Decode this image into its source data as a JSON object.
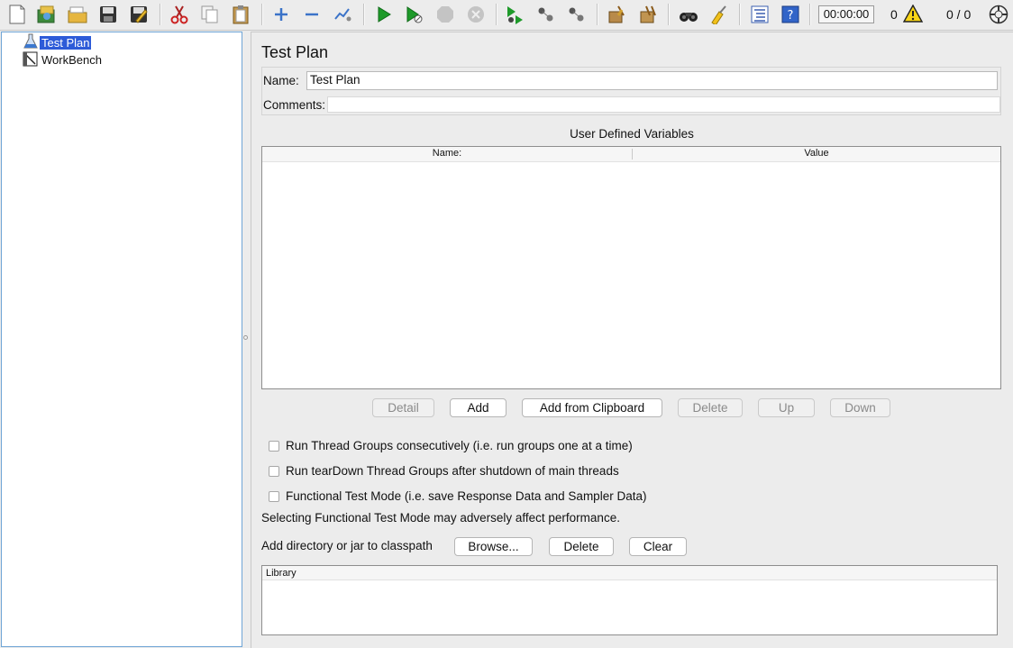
{
  "toolbar": {
    "icons": [
      "new-icon",
      "templates-icon",
      "open-icon",
      "save-icon",
      "save-as-icon",
      "cut-icon",
      "copy-icon",
      "paste-icon",
      "expand-icon",
      "collapse-icon",
      "toggle-icon",
      "start-icon",
      "start-no-pauses-icon",
      "stop-icon",
      "shutdown-icon",
      "remote-start-icon",
      "remote-stop-icon",
      "remote-shutdown-icon",
      "clear-icon",
      "clear-all-icon",
      "search-icon",
      "reset-search-icon",
      "function-helper-icon",
      "help-icon"
    ],
    "timer": "00:00:00",
    "error_count": "0",
    "thread_count": "0 / 0"
  },
  "tree": {
    "items": [
      {
        "label": "Test Plan",
        "icon": "flask-icon",
        "selected": true
      },
      {
        "label": "WorkBench",
        "icon": "workbench-icon",
        "selected": false
      }
    ]
  },
  "panel": {
    "title": "Test Plan",
    "name_label": "Name:",
    "name_value": "Test Plan",
    "comments_label": "Comments:",
    "comments_value": "",
    "variables_title": "User Defined Variables",
    "columns": [
      "Name:",
      "Value"
    ],
    "buttons": {
      "detail": "Detail",
      "add": "Add",
      "add_clipboard": "Add from Clipboard",
      "delete": "Delete",
      "up": "Up",
      "down": "Down"
    },
    "checkboxes": [
      {
        "label": "Run Thread Groups consecutively (i.e. run groups one at a time)",
        "checked": false
      },
      {
        "label": "Run tearDown Thread Groups after shutdown of main threads",
        "checked": false
      },
      {
        "label": "Functional Test Mode (i.e. save Response Data and Sampler Data)",
        "checked": false
      }
    ],
    "warning_text": "Selecting Functional Test Mode may adversely affect performance.",
    "classpath_label": "Add directory or jar to classpath",
    "classpath_buttons": {
      "browse": "Browse...",
      "delete": "Delete",
      "clear": "Clear"
    },
    "library_header": "Library"
  }
}
